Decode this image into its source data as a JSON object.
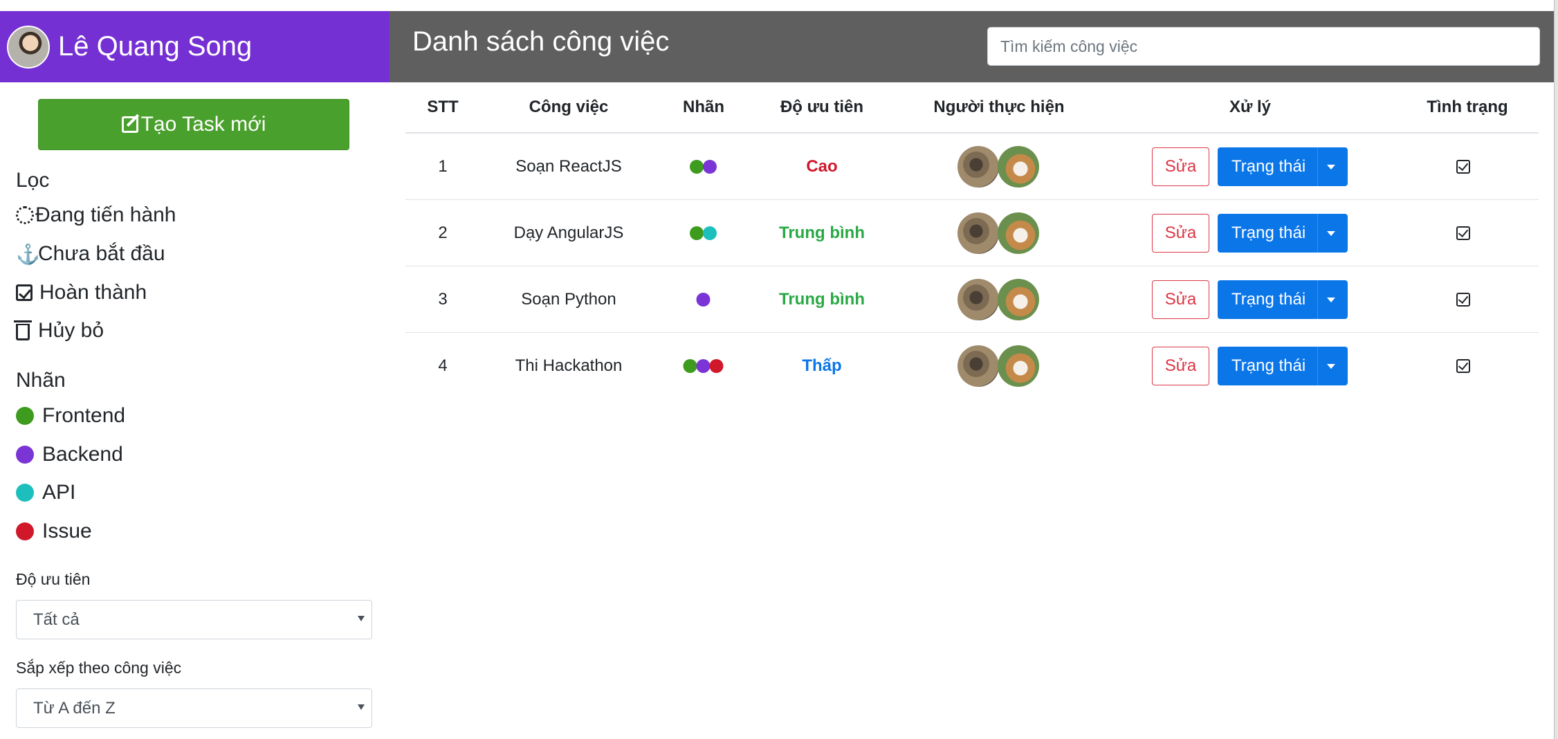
{
  "user": {
    "name": "Lê Quang Song"
  },
  "header": {
    "title": "Danh sách công việc",
    "search_placeholder": "Tìm kiếm công việc"
  },
  "sidebar": {
    "new_task_label": "Tạo Task mới",
    "filter_title": "Lọc",
    "filters": [
      {
        "label": "Đang tiến hành",
        "icon": "spinner-icon"
      },
      {
        "label": "Chưa bắt đầu",
        "icon": "anchor-icon"
      },
      {
        "label": "Hoàn thành",
        "icon": "check-square-icon"
      },
      {
        "label": "Hủy bỏ",
        "icon": "trash-icon"
      }
    ],
    "labels_title": "Nhãn",
    "labels": [
      {
        "label": "Frontend",
        "color": "#3d9b1e"
      },
      {
        "label": "Backend",
        "color": "#7b35d6"
      },
      {
        "label": "API",
        "color": "#1dbfbd"
      },
      {
        "label": "Issue",
        "color": "#d0182a"
      }
    ],
    "priority_title": "Độ ưu tiên",
    "priority_value": "Tất cả",
    "sort_title": "Sắp xếp theo công việc",
    "sort_value": "Từ A đến Z"
  },
  "table": {
    "headers": {
      "stt": "STT",
      "task": "Công việc",
      "labels": "Nhãn",
      "priority": "Độ ưu tiên",
      "assignees": "Người thực hiện",
      "actions": "Xử lý",
      "status": "Tình trạng"
    },
    "edit_label": "Sửa",
    "status_button_label": "Trạng thái",
    "rows": [
      {
        "stt": "1",
        "task": "Soạn ReactJS",
        "labels": [
          "#3d9b1e",
          "#7b35d6"
        ],
        "priority": "Cao",
        "priority_color": "#d0182a"
      },
      {
        "stt": "2",
        "task": "Dạy AngularJS",
        "labels": [
          "#3d9b1e",
          "#1dbfbd"
        ],
        "priority": "Trung bình",
        "priority_color": "#2aa845"
      },
      {
        "stt": "3",
        "task": "Soạn Python",
        "labels": [
          "#7b35d6"
        ],
        "priority": "Trung bình",
        "priority_color": "#2aa845"
      },
      {
        "stt": "4",
        "task": "Thi Hackathon",
        "labels": [
          "#3d9b1e",
          "#7b35d6",
          "#d0182a"
        ],
        "priority": "Thấp",
        "priority_color": "#0b76e8"
      }
    ]
  },
  "colors": {
    "brand": "#7530d4",
    "topbar": "#5f5f5f",
    "primary": "#0b76e8",
    "success": "#4aa02c",
    "danger": "#dc3545"
  }
}
